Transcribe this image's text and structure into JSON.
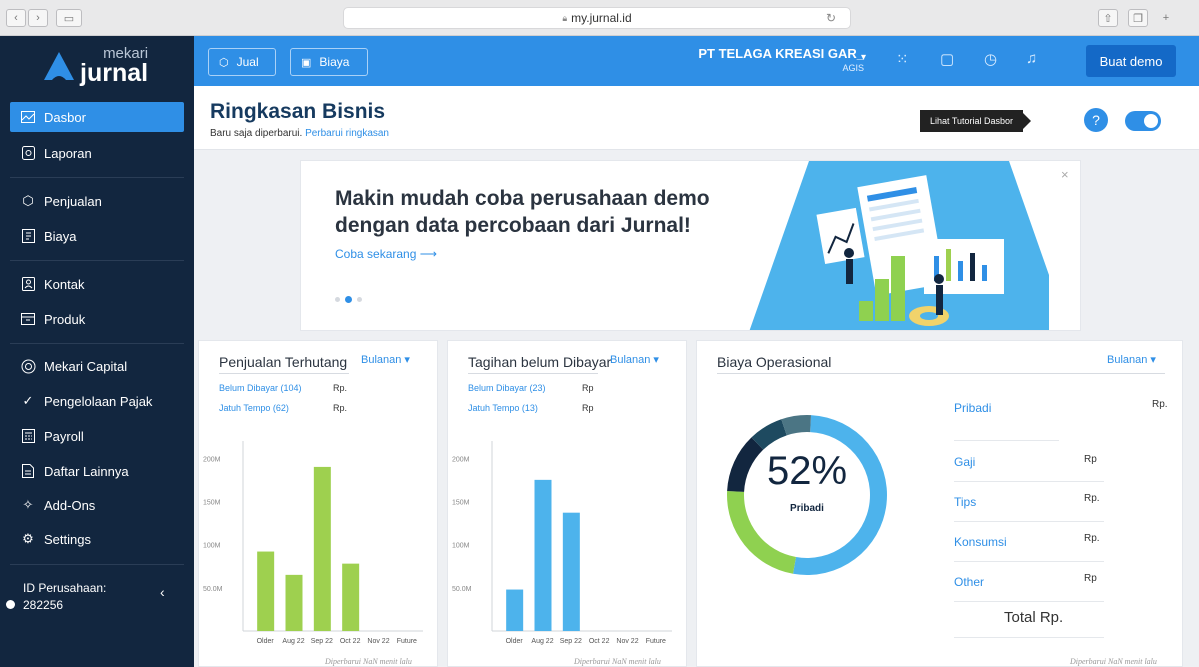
{
  "browser": {
    "url": "my.jurnal.id"
  },
  "brand": {
    "line1": "mekari",
    "line2": "jurnal"
  },
  "sidebar": {
    "items": [
      {
        "label": "Dasbor",
        "icon": "chart-area-icon"
      },
      {
        "label": "Laporan",
        "icon": "report-icon"
      },
      {
        "label": "Penjualan",
        "icon": "tag-icon"
      },
      {
        "label": "Biaya",
        "icon": "receipt-icon"
      },
      {
        "label": "Kontak",
        "icon": "contact-card-icon"
      },
      {
        "label": "Produk",
        "icon": "box-icon"
      },
      {
        "label": "Mekari Capital",
        "icon": "capital-icon"
      },
      {
        "label": "Pengelolaan Pajak",
        "icon": "tax-icon"
      },
      {
        "label": "Payroll",
        "icon": "calculator-icon"
      },
      {
        "label": "Daftar Lainnya",
        "icon": "document-list-icon"
      },
      {
        "label": "Add-Ons",
        "icon": "puzzle-icon"
      },
      {
        "label": "Settings",
        "icon": "gear-icon"
      }
    ],
    "company_label": "ID Perusahaan:",
    "company_id": "282256"
  },
  "topbar": {
    "jual_label": "Jual",
    "biaya_label": "Biaya",
    "company_name": "PT TELAGA KREASI GAR_",
    "company_sub": "AGIS",
    "buat_demo_label": "Buat demo"
  },
  "header": {
    "title": "Ringkasan Bisnis",
    "subtitle": "Baru saja diperbarui.",
    "refresh_link": "Perbarui ringkasan",
    "tutorial_label": "Lihat Tutorial Dasbor",
    "help_label": "?"
  },
  "banner": {
    "headline_line1": "Makin mudah coba perusahaan demo",
    "headline_line2": "dengan data percobaan dari Jurnal!",
    "cta": "Coba sekarang ⟶",
    "close": "×"
  },
  "accent_color": "#2f8fe6",
  "cards": {
    "penjualan": {
      "title": "Penjualan Terhutang",
      "period": "Bulanan ▾",
      "rows": [
        {
          "label": "Belum Dibayar (104)",
          "value": "Rp."
        },
        {
          "label": "Jatuh Tempo (62)",
          "value": "Rp."
        }
      ],
      "updated": "Diperbarui NaN menit lalu"
    },
    "tagihan": {
      "title": "Tagihan belum Dibayar",
      "period": "Bulanan ▾",
      "rows": [
        {
          "label": "Belum Dibayar (23)",
          "value": "Rp"
        },
        {
          "label": "Jatuh Tempo (13)",
          "value": "Rp"
        }
      ],
      "updated": "Diperbarui NaN menit lalu"
    },
    "biaya": {
      "title": "Biaya Operasional",
      "period": "Bulanan ▾",
      "donut_value": "52%",
      "donut_label": "Pribadi",
      "items": [
        {
          "label": "Pribadi",
          "value": "Rp."
        },
        {
          "label": "Gaji",
          "value": "Rp"
        },
        {
          "label": "Tips",
          "value": "Rp."
        },
        {
          "label": "Konsumsi",
          "value": "Rp."
        },
        {
          "label": "Other",
          "value": "Rp"
        }
      ],
      "total": "Total Rp.",
      "updated": "Diperbarui NaN menit lalu"
    }
  },
  "chart_data": [
    {
      "type": "bar",
      "categories": [
        "Older",
        "Aug 22",
        "Sep 22",
        "Oct 22",
        "Nov 22",
        "Future"
      ],
      "values": [
        92,
        65,
        190,
        78,
        0,
        0
      ],
      "yticks": [
        "200M",
        "150M",
        "100M",
        "50.0M"
      ],
      "ylim": [
        0,
        220
      ],
      "color": "#9ed04f"
    },
    {
      "type": "bar",
      "categories": [
        "Older",
        "Aug 22",
        "Sep 22",
        "Oct 22",
        "Nov 22",
        "Future"
      ],
      "values": [
        48,
        175,
        137,
        0,
        0,
        0
      ],
      "yticks": [
        "200M",
        "150M",
        "100M",
        "50.0M"
      ],
      "ylim": [
        0,
        220
      ],
      "color": "#4db3ec"
    },
    {
      "type": "pie",
      "categories": [
        "Pribadi",
        "Gaji",
        "Tips",
        "Konsumsi",
        "Other"
      ],
      "values": [
        52,
        23,
        12,
        7,
        6
      ],
      "colors": [
        "#4db3ec",
        "#8fd150",
        "#12263f",
        "#1e4a60",
        "#4b7584"
      ]
    }
  ]
}
